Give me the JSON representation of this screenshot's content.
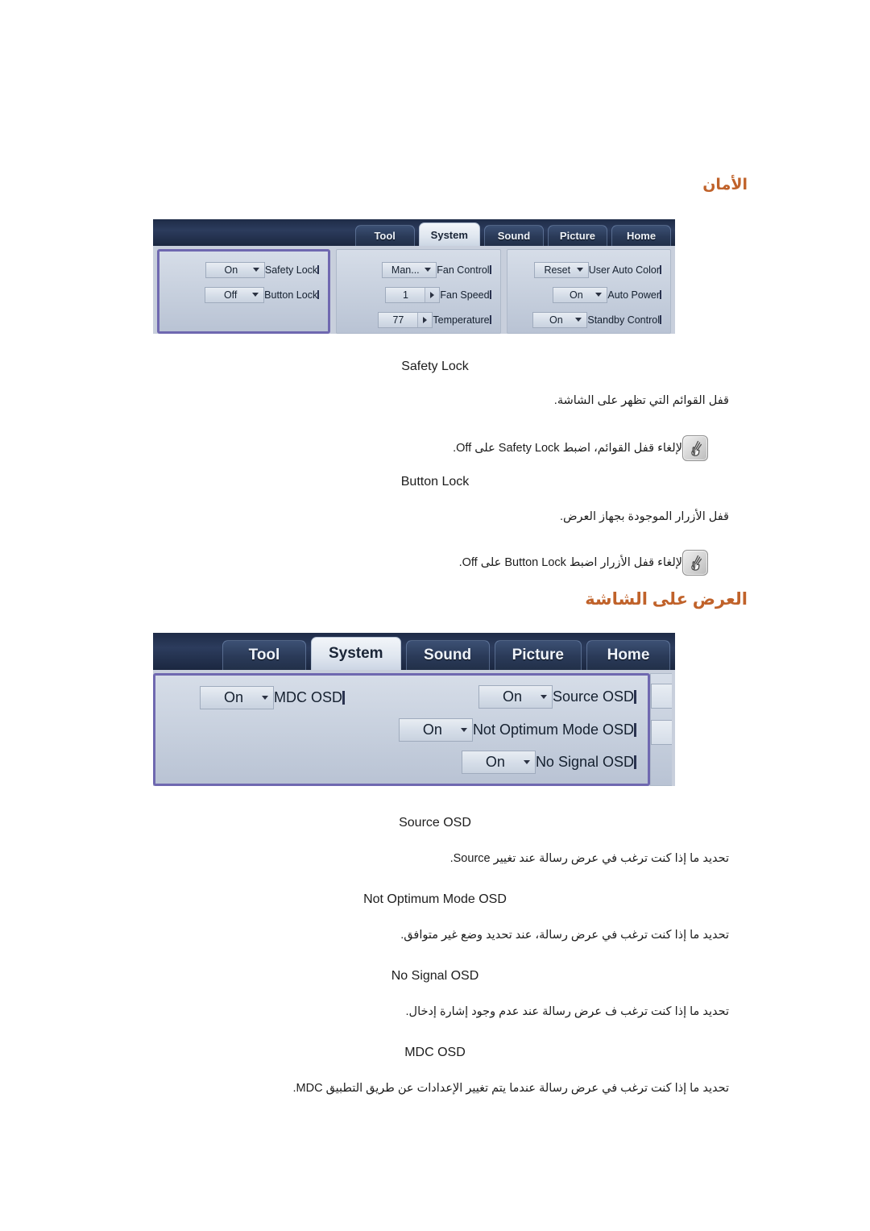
{
  "headings": {
    "security": "الأمان",
    "osd": "العرض على الشاشة"
  },
  "screenshot_security": {
    "name": "MDC System tab - Security",
    "tabs": [
      {
        "label": "Home",
        "active": false
      },
      {
        "label": "Picture",
        "active": false
      },
      {
        "label": "Sound",
        "active": false
      },
      {
        "label": "System",
        "active": true
      },
      {
        "label": "Tool",
        "active": false
      }
    ],
    "panel_left": [
      {
        "label": "User Auto Color",
        "value": "Reset",
        "control": "dropdown"
      },
      {
        "label": "Auto Power",
        "value": "On",
        "control": "dropdown"
      },
      {
        "label": "Standby Control",
        "value": "On",
        "control": "dropdown"
      }
    ],
    "panel_middle": [
      {
        "label": "Fan Control",
        "value": "Man...",
        "control": "dropdown"
      },
      {
        "label": "Fan Speed",
        "value": "1",
        "control": "spinner"
      },
      {
        "label": "Temperature",
        "value": "77",
        "control": "spinner"
      }
    ],
    "panel_highlight": [
      {
        "label": "Safety Lock",
        "value": "On",
        "control": "dropdown"
      },
      {
        "label": "Button Lock",
        "value": "Off",
        "control": "dropdown"
      }
    ]
  },
  "screenshot_osd": {
    "name": "MDC System tab - On Screen Display",
    "tabs": [
      {
        "label": "Home",
        "active": false
      },
      {
        "label": "Picture",
        "active": false
      },
      {
        "label": "Sound",
        "active": false
      },
      {
        "label": "System",
        "active": true
      },
      {
        "label": "Tool",
        "active": false
      }
    ],
    "panel_left": [
      {
        "label": "Source OSD",
        "value": "On",
        "control": "dropdown"
      },
      {
        "label": "Not Optimum Mode OSD",
        "value": "On",
        "control": "dropdown"
      },
      {
        "label": "No Signal OSD",
        "value": "On",
        "control": "dropdown"
      }
    ],
    "panel_right": [
      {
        "label": "MDC OSD",
        "value": "On",
        "control": "dropdown"
      }
    ]
  },
  "security_section": {
    "items": [
      {
        "term": "Safety Lock",
        "description": "قفل القوائم التي تظهر على الشاشة.",
        "note": "لإلغاء قفل القوائم، اضبط Safety Lock على Off."
      },
      {
        "term": "Button Lock",
        "description": "قفل الأزرار الموجودة بجهاز العرض.",
        "note": "لإلغاء قفل الأزرار اضبط Button Lock على Off."
      }
    ]
  },
  "osd_section": {
    "items": [
      {
        "term": "Source OSD",
        "description": "تحديد ما إذا كنت ترغب في عرض رسالة عند تغيير Source."
      },
      {
        "term": "Not Optimum Mode OSD",
        "description": "تحديد ما إذا كنت ترغب في عرض رسالة، عند تحديد وضع غير متوافق."
      },
      {
        "term": "No Signal OSD",
        "description": "تحديد ما إذا كنت ترغب ف عرض رسالة عند عدم وجود إشارة إدخال."
      },
      {
        "term": "MDC OSD",
        "description": "تحديد ما إذا كنت ترغب في عرض رسالة عندما يتم تغيير الإعدادات عن طريق التطبيق MDC."
      }
    ]
  },
  "colors": {
    "heading_orange": "#c0622a",
    "highlight_purple": "#6f68b0",
    "tabbar_navy": "#1e2b47",
    "panel_blue_grey": "#c6cfdd"
  },
  "icons": {
    "note": "note-hand-icon"
  }
}
